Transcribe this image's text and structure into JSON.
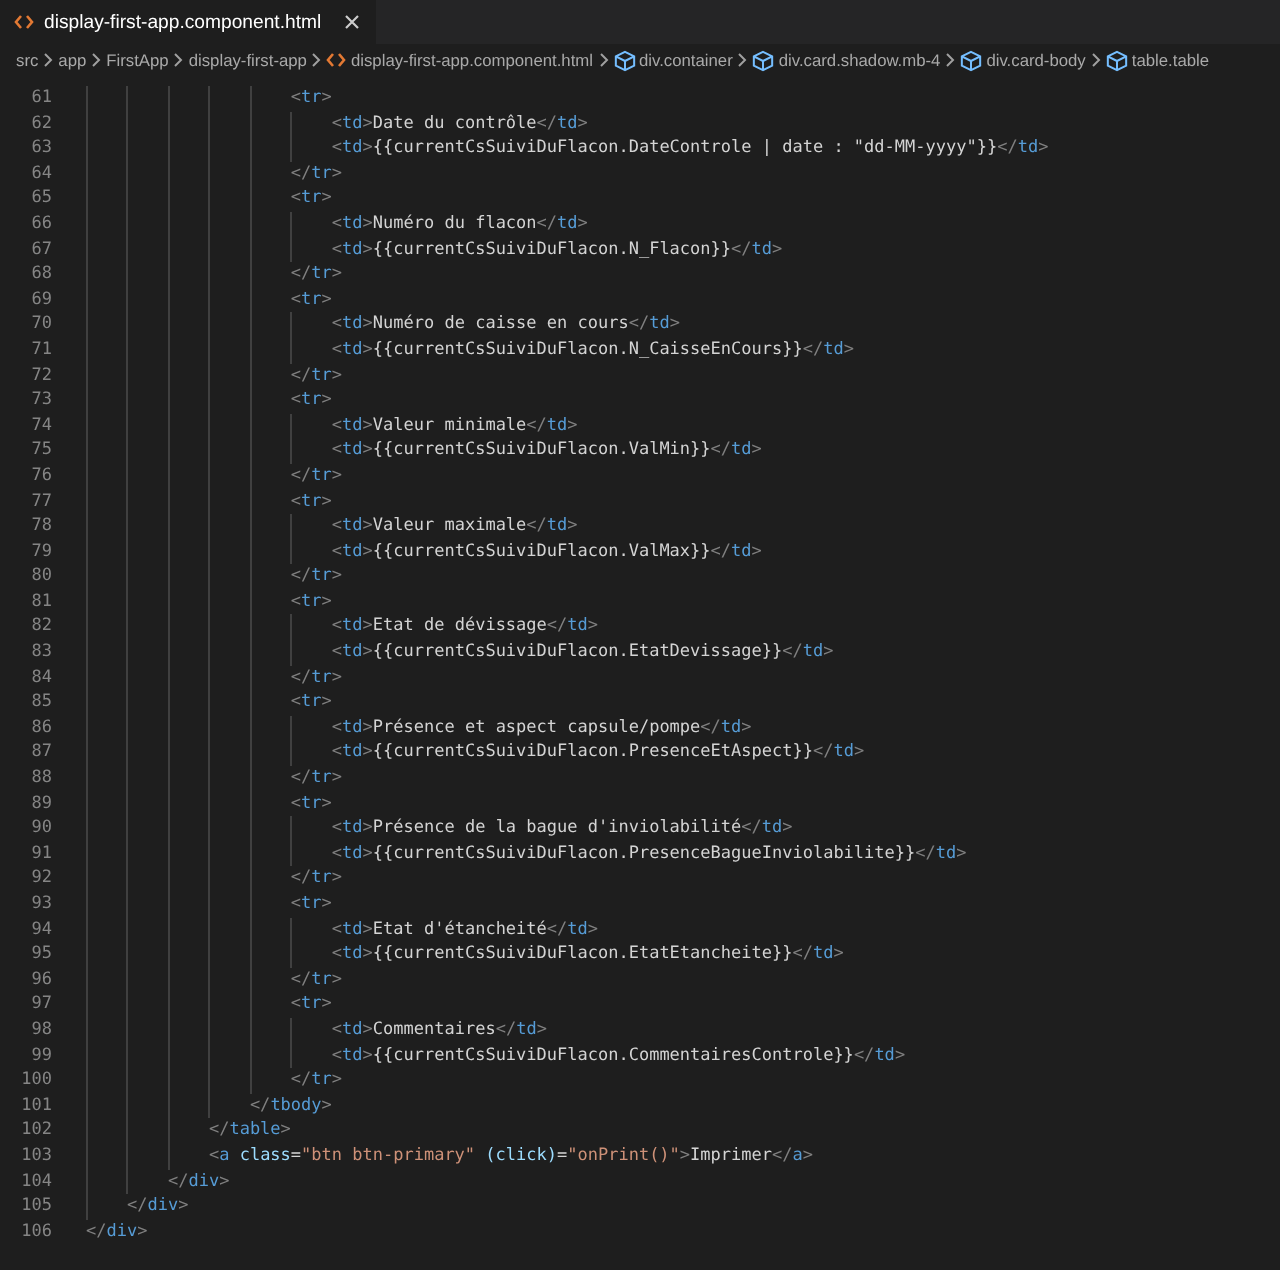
{
  "tab": {
    "title": "display-first-app.component.html",
    "selected": true
  },
  "breadcrumbs": [
    {
      "label": "src",
      "kind": "folder"
    },
    {
      "label": "app",
      "kind": "folder"
    },
    {
      "label": "FirstApp",
      "kind": "folder"
    },
    {
      "label": "display-first-app",
      "kind": "folder"
    },
    {
      "label": "display-first-app.component.html",
      "kind": "file"
    },
    {
      "label": "div.container",
      "kind": "element"
    },
    {
      "label": "div.card.shadow.mb-4",
      "kind": "element"
    },
    {
      "label": "div.card-body",
      "kind": "element"
    },
    {
      "label": "table.table",
      "kind": "element"
    }
  ],
  "lines": [
    {
      "number": "61",
      "text": "                    <tr>"
    },
    {
      "number": "62",
      "text": "                        <td>Date du contrôle</td>"
    },
    {
      "number": "63",
      "text": "                        <td>{{currentCsSuiviDuFlacon.DateControle | date : \"dd-MM-yyyy\"}}</td>"
    },
    {
      "number": "64",
      "text": "                    </tr>"
    },
    {
      "number": "65",
      "text": "                    <tr>"
    },
    {
      "number": "66",
      "text": "                        <td>Numéro du flacon</td>"
    },
    {
      "number": "67",
      "text": "                        <td>{{currentCsSuiviDuFlacon.N_Flacon}}</td>"
    },
    {
      "number": "68",
      "text": "                    </tr>"
    },
    {
      "number": "69",
      "text": "                    <tr>"
    },
    {
      "number": "70",
      "text": "                        <td>Numéro de caisse en cours</td>"
    },
    {
      "number": "71",
      "text": "                        <td>{{currentCsSuiviDuFlacon.N_CaisseEnCours}}</td>"
    },
    {
      "number": "72",
      "text": "                    </tr>"
    },
    {
      "number": "73",
      "text": "                    <tr>"
    },
    {
      "number": "74",
      "text": "                        <td>Valeur minimale</td>"
    },
    {
      "number": "75",
      "text": "                        <td>{{currentCsSuiviDuFlacon.ValMin}}</td>"
    },
    {
      "number": "76",
      "text": "                    </tr>"
    },
    {
      "number": "77",
      "text": "                    <tr>"
    },
    {
      "number": "78",
      "text": "                        <td>Valeur maximale</td>"
    },
    {
      "number": "79",
      "text": "                        <td>{{currentCsSuiviDuFlacon.ValMax}}</td>"
    },
    {
      "number": "80",
      "text": "                    </tr>"
    },
    {
      "number": "81",
      "text": "                    <tr>"
    },
    {
      "number": "82",
      "text": "                        <td>Etat de dévissage</td>"
    },
    {
      "number": "83",
      "text": "                        <td>{{currentCsSuiviDuFlacon.EtatDevissage}}</td>"
    },
    {
      "number": "84",
      "text": "                    </tr>"
    },
    {
      "number": "85",
      "text": "                    <tr>"
    },
    {
      "number": "86",
      "text": "                        <td>Présence et aspect capsule/pompe</td>"
    },
    {
      "number": "87",
      "text": "                        <td>{{currentCsSuiviDuFlacon.PresenceEtAspect}}</td>"
    },
    {
      "number": "88",
      "text": "                    </tr>"
    },
    {
      "number": "89",
      "text": "                    <tr>"
    },
    {
      "number": "90",
      "text": "                        <td>Présence de la bague d'inviolabilité</td>"
    },
    {
      "number": "91",
      "text": "                        <td>{{currentCsSuiviDuFlacon.PresenceBagueInviolabilite}}</td>"
    },
    {
      "number": "92",
      "text": "                    </tr>"
    },
    {
      "number": "93",
      "text": "                    <tr>"
    },
    {
      "number": "94",
      "text": "                        <td>Etat d'étancheité</td>"
    },
    {
      "number": "95",
      "text": "                        <td>{{currentCsSuiviDuFlacon.EtatEtancheite}}</td>"
    },
    {
      "number": "96",
      "text": "                    </tr>"
    },
    {
      "number": "97",
      "text": "                    <tr>"
    },
    {
      "number": "98",
      "text": "                        <td>Commentaires</td>"
    },
    {
      "number": "99",
      "text": "                        <td>{{currentCsSuiviDuFlacon.CommentairesControle}}</td>"
    },
    {
      "number": "100",
      "text": "                    </tr>"
    },
    {
      "number": "101",
      "text": "                </tbody>"
    },
    {
      "number": "102",
      "text": "            </table>"
    },
    {
      "number": "103",
      "text": "            <a class=\"btn btn-primary\" (click)=\"onPrint()\">Imprimer</a>"
    },
    {
      "number": "104",
      "text": "        </div>"
    },
    {
      "number": "105",
      "text": "    </div>"
    },
    {
      "number": "106",
      "text": "</div>"
    }
  ]
}
